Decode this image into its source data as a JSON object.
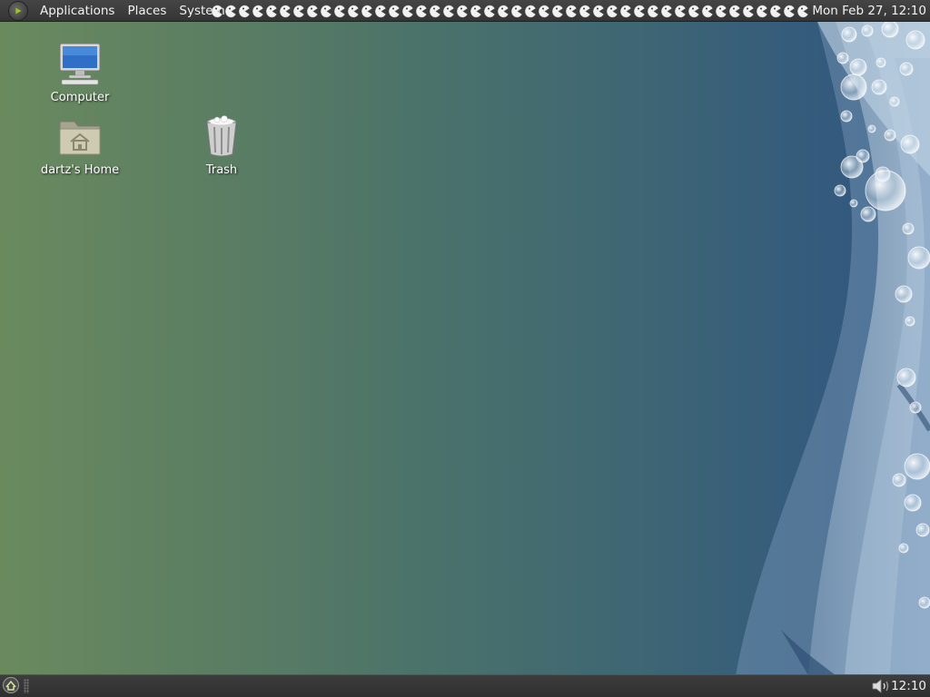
{
  "top_panel": {
    "menus": [
      "Applications",
      "Places",
      "System"
    ],
    "launcher_count": 44,
    "launcher_icon": "pacman-launcher-icon",
    "clock": "Mon Feb 27, 12:10"
  },
  "bottom_panel": {
    "show_desktop_icon": "show-desktop-icon",
    "volume_icon": "speaker-icon",
    "clock": "12:10"
  },
  "desktop": {
    "icons": [
      {
        "label": "Computer",
        "icon": "monitor-icon"
      },
      {
        "label": "dartz's Home",
        "icon": "home-folder-icon"
      },
      {
        "label": "Trash",
        "icon": "trash-icon"
      }
    ]
  },
  "colors": {
    "panel_bg": "#3b3b3b",
    "wallpaper_left": "#6a8a5e",
    "wallpaper_right": "#2f5680",
    "wave_color": "#b9cde0"
  }
}
